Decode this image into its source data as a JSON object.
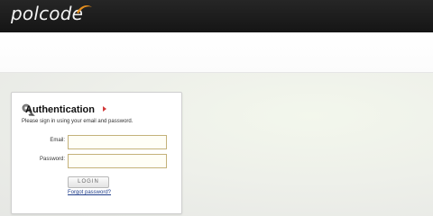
{
  "header": {
    "logo_text": "polcode"
  },
  "login": {
    "title": "Authentication",
    "instructions": "Please sign in using your email and password.",
    "email_label": "Email:",
    "email_value": "",
    "password_label": "Password:",
    "password_value": "",
    "login_button": "LOGIN",
    "forgot_link": "Forgot password?"
  },
  "colors": {
    "topbar": "#1d1d1d",
    "field_border": "#c4b27a",
    "link": "#1f3d8a",
    "arrow": "#d33a3a",
    "logo_accent": "#e8901e"
  },
  "icons": {
    "logo_swoosh": "orange-swoosh-icon",
    "title_icon": "key-icon",
    "title_arrow": "arrow-right-icon"
  }
}
